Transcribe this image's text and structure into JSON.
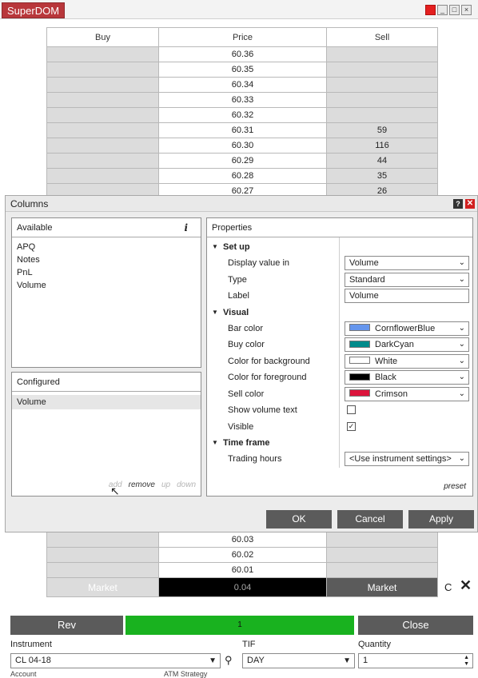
{
  "window": {
    "title": "SuperDOM",
    "controls": [
      "red",
      "_",
      "□",
      "×"
    ]
  },
  "ladder_header": {
    "buy": "Buy",
    "price": "Price",
    "sell": "Sell"
  },
  "top_rows": [
    {
      "price": "60.36",
      "sell": ""
    },
    {
      "price": "60.35",
      "sell": ""
    },
    {
      "price": "60.34",
      "sell": ""
    },
    {
      "price": "60.33",
      "sell": ""
    },
    {
      "price": "60.32",
      "sell": ""
    },
    {
      "price": "60.31",
      "sell": "59"
    },
    {
      "price": "60.30",
      "sell": "116"
    },
    {
      "price": "60.29",
      "sell": "44"
    },
    {
      "price": "60.28",
      "sell": "35"
    },
    {
      "price": "60.27",
      "sell": "26"
    }
  ],
  "bottom_rows": [
    {
      "price": "60.03"
    },
    {
      "price": "60.02"
    },
    {
      "price": "60.01"
    }
  ],
  "market_row": {
    "left": "Market",
    "center": "0.04",
    "right": "Market",
    "c_label": "C",
    "x_label": "✕"
  },
  "actions": {
    "rev": "Rev",
    "qty_bar": "1",
    "close": "Close"
  },
  "fields": {
    "instrument_label": "Instrument",
    "instrument_value": "CL 04-18",
    "tif_label": "TIF",
    "tif_value": "DAY",
    "quantity_label": "Quantity",
    "quantity_value": "1",
    "account_label_partial": "Account",
    "atm_label_partial": "ATM Strategy"
  },
  "dialog": {
    "title": "Columns",
    "available": {
      "header": "Available",
      "items": [
        "APQ",
        "Notes",
        "PnL",
        "Volume"
      ]
    },
    "configured": {
      "header": "Configured",
      "items": [
        "Volume"
      ],
      "actions": {
        "add": "add",
        "remove": "remove",
        "up": "up",
        "down": "down"
      }
    },
    "properties": {
      "header": "Properties",
      "sections": {
        "setup": {
          "title": "Set up",
          "display_value_in": {
            "label": "Display value in",
            "value": "Volume"
          },
          "type": {
            "label": "Type",
            "value": "Standard"
          },
          "label": {
            "label": "Label",
            "value": "Volume"
          }
        },
        "visual": {
          "title": "Visual",
          "bar_color": {
            "label": "Bar color",
            "value": "CornflowerBlue",
            "hex": "#6495ED"
          },
          "buy_color": {
            "label": "Buy color",
            "value": "DarkCyan",
            "hex": "#008B8B"
          },
          "bg_color": {
            "label": "Color for background",
            "value": "White",
            "hex": "#FFFFFF"
          },
          "fg_color": {
            "label": "Color for foreground",
            "value": "Black",
            "hex": "#000000"
          },
          "sell_color": {
            "label": "Sell color",
            "value": "Crimson",
            "hex": "#DC143C"
          },
          "show_volume_text": {
            "label": "Show volume text",
            "checked": false
          },
          "visible": {
            "label": "Visible",
            "checked": true
          }
        },
        "timeframe": {
          "title": "Time frame",
          "trading_hours": {
            "label": "Trading hours",
            "value": "<Use instrument settings>"
          }
        }
      },
      "preset": "preset"
    },
    "buttons": {
      "ok": "OK",
      "cancel": "Cancel",
      "apply": "Apply"
    }
  }
}
